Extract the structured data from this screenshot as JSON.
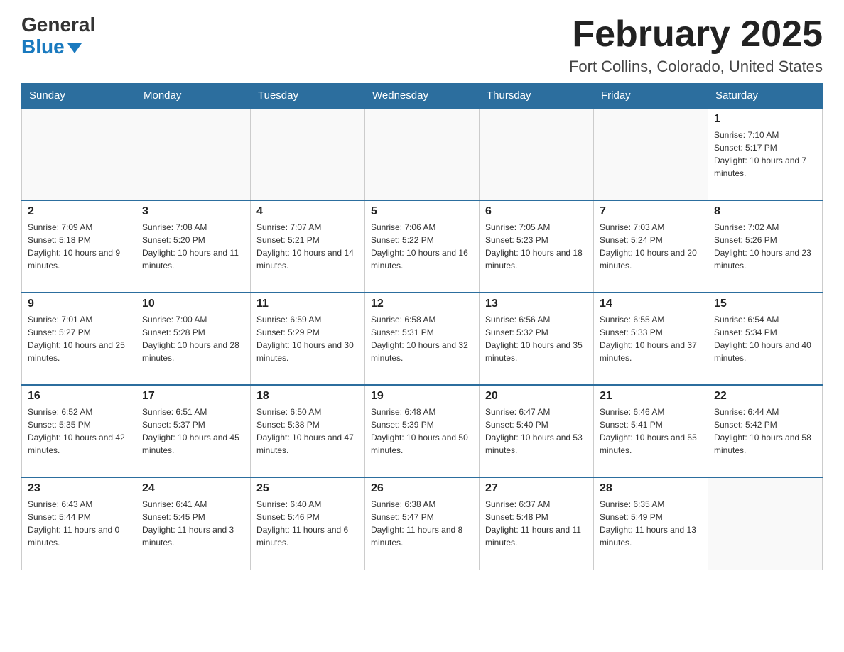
{
  "header": {
    "logo_general": "General",
    "logo_blue": "Blue",
    "month_title": "February 2025",
    "location": "Fort Collins, Colorado, United States"
  },
  "weekdays": [
    "Sunday",
    "Monday",
    "Tuesday",
    "Wednesday",
    "Thursday",
    "Friday",
    "Saturday"
  ],
  "weeks": [
    [
      {
        "day": "",
        "info": ""
      },
      {
        "day": "",
        "info": ""
      },
      {
        "day": "",
        "info": ""
      },
      {
        "day": "",
        "info": ""
      },
      {
        "day": "",
        "info": ""
      },
      {
        "day": "",
        "info": ""
      },
      {
        "day": "1",
        "info": "Sunrise: 7:10 AM\nSunset: 5:17 PM\nDaylight: 10 hours and 7 minutes."
      }
    ],
    [
      {
        "day": "2",
        "info": "Sunrise: 7:09 AM\nSunset: 5:18 PM\nDaylight: 10 hours and 9 minutes."
      },
      {
        "day": "3",
        "info": "Sunrise: 7:08 AM\nSunset: 5:20 PM\nDaylight: 10 hours and 11 minutes."
      },
      {
        "day": "4",
        "info": "Sunrise: 7:07 AM\nSunset: 5:21 PM\nDaylight: 10 hours and 14 minutes."
      },
      {
        "day": "5",
        "info": "Sunrise: 7:06 AM\nSunset: 5:22 PM\nDaylight: 10 hours and 16 minutes."
      },
      {
        "day": "6",
        "info": "Sunrise: 7:05 AM\nSunset: 5:23 PM\nDaylight: 10 hours and 18 minutes."
      },
      {
        "day": "7",
        "info": "Sunrise: 7:03 AM\nSunset: 5:24 PM\nDaylight: 10 hours and 20 minutes."
      },
      {
        "day": "8",
        "info": "Sunrise: 7:02 AM\nSunset: 5:26 PM\nDaylight: 10 hours and 23 minutes."
      }
    ],
    [
      {
        "day": "9",
        "info": "Sunrise: 7:01 AM\nSunset: 5:27 PM\nDaylight: 10 hours and 25 minutes."
      },
      {
        "day": "10",
        "info": "Sunrise: 7:00 AM\nSunset: 5:28 PM\nDaylight: 10 hours and 28 minutes."
      },
      {
        "day": "11",
        "info": "Sunrise: 6:59 AM\nSunset: 5:29 PM\nDaylight: 10 hours and 30 minutes."
      },
      {
        "day": "12",
        "info": "Sunrise: 6:58 AM\nSunset: 5:31 PM\nDaylight: 10 hours and 32 minutes."
      },
      {
        "day": "13",
        "info": "Sunrise: 6:56 AM\nSunset: 5:32 PM\nDaylight: 10 hours and 35 minutes."
      },
      {
        "day": "14",
        "info": "Sunrise: 6:55 AM\nSunset: 5:33 PM\nDaylight: 10 hours and 37 minutes."
      },
      {
        "day": "15",
        "info": "Sunrise: 6:54 AM\nSunset: 5:34 PM\nDaylight: 10 hours and 40 minutes."
      }
    ],
    [
      {
        "day": "16",
        "info": "Sunrise: 6:52 AM\nSunset: 5:35 PM\nDaylight: 10 hours and 42 minutes."
      },
      {
        "day": "17",
        "info": "Sunrise: 6:51 AM\nSunset: 5:37 PM\nDaylight: 10 hours and 45 minutes."
      },
      {
        "day": "18",
        "info": "Sunrise: 6:50 AM\nSunset: 5:38 PM\nDaylight: 10 hours and 47 minutes."
      },
      {
        "day": "19",
        "info": "Sunrise: 6:48 AM\nSunset: 5:39 PM\nDaylight: 10 hours and 50 minutes."
      },
      {
        "day": "20",
        "info": "Sunrise: 6:47 AM\nSunset: 5:40 PM\nDaylight: 10 hours and 53 minutes."
      },
      {
        "day": "21",
        "info": "Sunrise: 6:46 AM\nSunset: 5:41 PM\nDaylight: 10 hours and 55 minutes."
      },
      {
        "day": "22",
        "info": "Sunrise: 6:44 AM\nSunset: 5:42 PM\nDaylight: 10 hours and 58 minutes."
      }
    ],
    [
      {
        "day": "23",
        "info": "Sunrise: 6:43 AM\nSunset: 5:44 PM\nDaylight: 11 hours and 0 minutes."
      },
      {
        "day": "24",
        "info": "Sunrise: 6:41 AM\nSunset: 5:45 PM\nDaylight: 11 hours and 3 minutes."
      },
      {
        "day": "25",
        "info": "Sunrise: 6:40 AM\nSunset: 5:46 PM\nDaylight: 11 hours and 6 minutes."
      },
      {
        "day": "26",
        "info": "Sunrise: 6:38 AM\nSunset: 5:47 PM\nDaylight: 11 hours and 8 minutes."
      },
      {
        "day": "27",
        "info": "Sunrise: 6:37 AM\nSunset: 5:48 PM\nDaylight: 11 hours and 11 minutes."
      },
      {
        "day": "28",
        "info": "Sunrise: 6:35 AM\nSunset: 5:49 PM\nDaylight: 11 hours and 13 minutes."
      },
      {
        "day": "",
        "info": ""
      }
    ]
  ]
}
